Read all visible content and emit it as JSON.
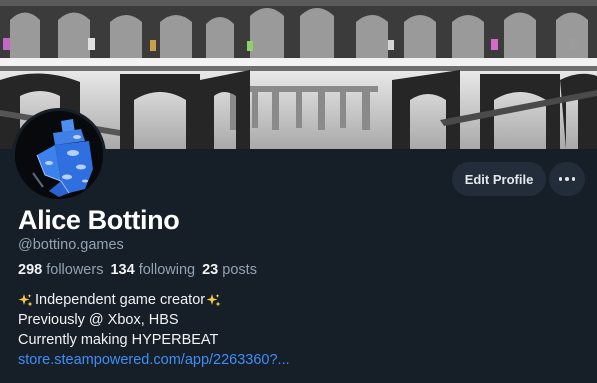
{
  "profile": {
    "display_name": "Alice Bottino",
    "handle": "@bottino.games",
    "stats": {
      "followers_count": "298",
      "followers_label": "followers",
      "following_count": "134",
      "following_label": "following",
      "posts_count": "23",
      "posts_label": "posts"
    },
    "bio": {
      "line1": "Independent game creator",
      "line2": "Previously @ Xbox, HBS",
      "line3": "Currently making HYPERBEAT",
      "link": "store.steampowered.com/app/2263360?..."
    }
  },
  "actions": {
    "edit_profile_label": "Edit Profile",
    "more_icon": "ellipsis-icon"
  },
  "icons": {
    "sparkle": "sparkles-icon"
  },
  "colors": {
    "background": "#161e27",
    "button_bg": "#232d39",
    "muted_text": "#93a2b3",
    "link": "#3d8ef7"
  }
}
